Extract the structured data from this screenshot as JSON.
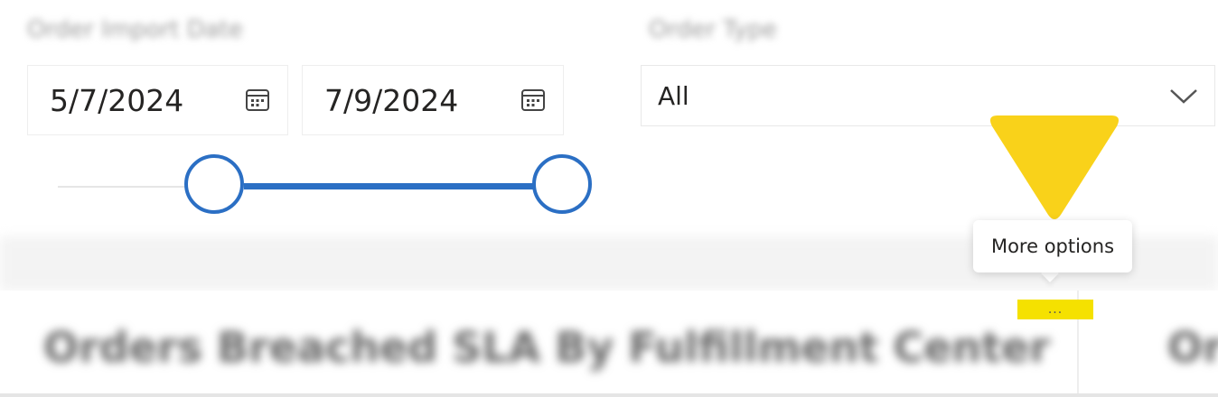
{
  "filters": {
    "order_import_date": {
      "label": "Order Import Date",
      "start": "5/7/2024",
      "end": "7/9/2024"
    },
    "order_type": {
      "label": "Order Type",
      "selected": "All"
    }
  },
  "tooltip": {
    "text": "More options"
  },
  "more_button": {
    "glyph": "..."
  },
  "visual": {
    "title": "Orders Breached SLA By Fulfillment Center",
    "next_title_partial": "Or"
  },
  "colors": {
    "slider_accent": "#2b6fc4",
    "highlight_arrow": "#f9d21a",
    "highlight_box": "#f5e100"
  },
  "icons": {
    "date_picker": "calendar-icon",
    "dropdown": "chevron-down-icon",
    "more": "ellipsis-icon"
  }
}
